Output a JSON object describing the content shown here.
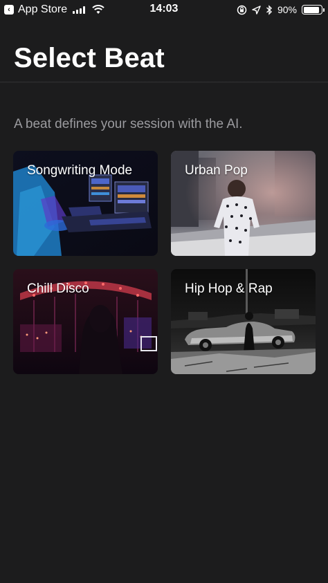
{
  "status_bar": {
    "back_app": "App Store",
    "time": "14:03",
    "battery_percent": "90%",
    "battery_level": 0.9,
    "icons": [
      "back-icon",
      "signal-icon",
      "wifi-icon",
      "orientation-lock-icon",
      "location-icon",
      "bluetooth-icon",
      "battery-icon"
    ]
  },
  "header": {
    "title": "Select Beat"
  },
  "subtitle": "A beat defines your session with the AI.",
  "beats": [
    {
      "label": "Songwriting Mode"
    },
    {
      "label": "Urban Pop"
    },
    {
      "label": "Chill Disco"
    },
    {
      "label": "Hip Hop & Rap"
    }
  ],
  "colors": {
    "background": "#1c1c1d",
    "text_primary": "#ffffff",
    "text_secondary": "#9b9b9f"
  }
}
